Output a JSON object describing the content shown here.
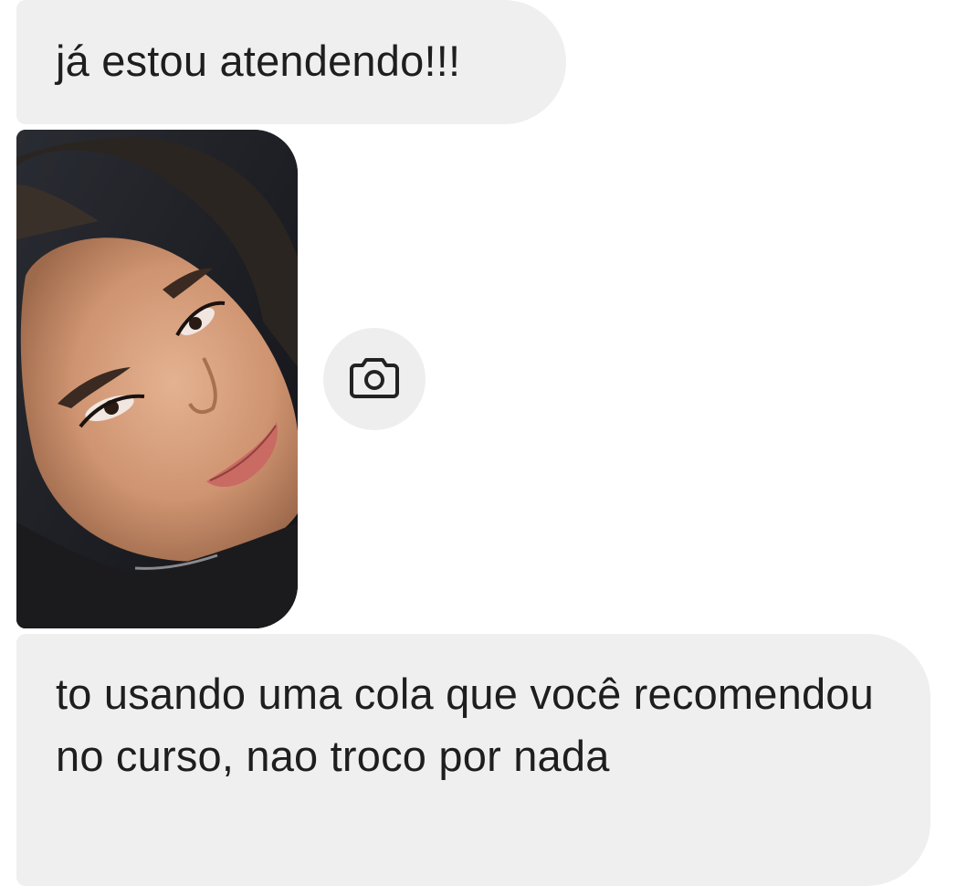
{
  "messages": [
    {
      "type": "text",
      "text": "já estou atendendo!!!"
    },
    {
      "type": "photo"
    },
    {
      "type": "text",
      "text": "to usando uma cola que você recomendou no curso, nao troco por nada"
    }
  ],
  "photo_action": {
    "icon": "camera-icon"
  },
  "colors": {
    "bubble": "#efefef",
    "text": "#1e1e1e",
    "background": "#ffffff",
    "icon": "#222222"
  }
}
